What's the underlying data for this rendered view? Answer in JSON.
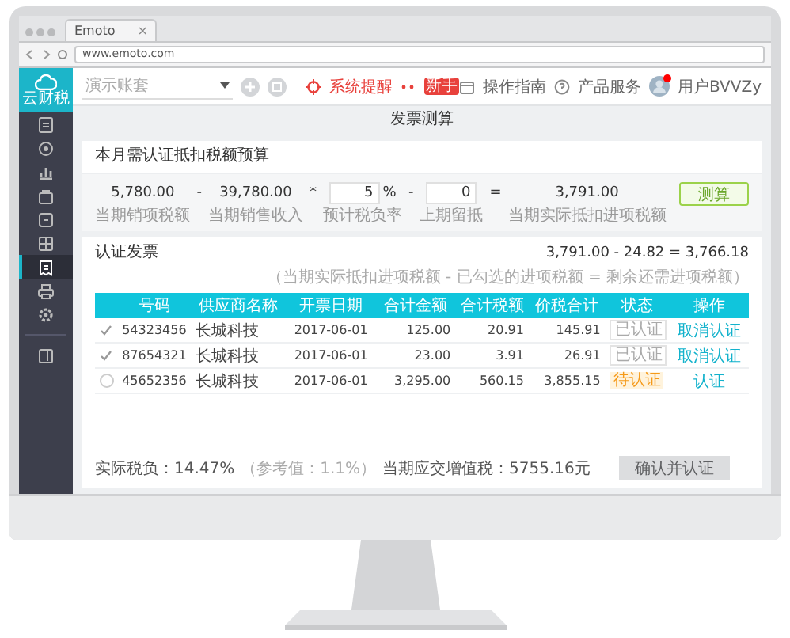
{
  "browser": {
    "tab_title": "Emoto",
    "tab_close": "×",
    "url": "www.emoto.com"
  },
  "header": {
    "logo_text": "云财税",
    "company_select": {
      "placeholder": "演示账套"
    },
    "alert": "系统提醒",
    "new_badge": "新手",
    "guide": "操作指南",
    "service": "产品服务",
    "user": "用户BVVZy",
    "user_notification": true
  },
  "sidebar": {
    "items": [
      {
        "selected": false
      },
      {
        "selected": false
      },
      {
        "selected": false
      },
      {
        "selected": false
      },
      {
        "selected": false
      },
      {
        "selected": false
      },
      {
        "selected": true
      },
      {
        "selected": false
      },
      {
        "selected": false
      },
      {
        "selected": false
      }
    ]
  },
  "page_title": "发票测算",
  "estimate": {
    "title": "本月需认证抵扣税额预算",
    "terms": [
      {
        "kind": "value",
        "value": "5,780.00",
        "label": "当期销项税额"
      },
      {
        "kind": "operator",
        "value": "-"
      },
      {
        "kind": "value",
        "value": "39,780.00",
        "label": "当期销售收入"
      },
      {
        "kind": "operator",
        "value": "*"
      },
      {
        "kind": "input",
        "value": "5",
        "unit": "%",
        "label": "预计税负率"
      },
      {
        "kind": "operator",
        "value": "-"
      },
      {
        "kind": "input",
        "value": "0",
        "label": "上期留抵"
      },
      {
        "kind": "operator",
        "value": "="
      },
      {
        "kind": "value",
        "value": "3,791.00",
        "label": "当期实际抵扣进项税额"
      }
    ],
    "button": "测算"
  },
  "invoices": {
    "title": "认证发票",
    "formula": "3,791.00 - 24.82 = 3,766.18",
    "note": "（当期实际抵扣进项税额 - 已勾选的进项税额 = 剩余还需进项税额）",
    "columns": [
      "号码",
      "供应商名称",
      "开票日期",
      "合计金额",
      "合计税额",
      "价税合计",
      "状态",
      "操作"
    ],
    "rows": [
      {
        "checked": true,
        "cells": [
          "54323456",
          "长城科技",
          "2017-06-01",
          "125.00",
          "20.91",
          "145.91"
        ],
        "status": {
          "text": "已认证",
          "kind": "certified"
        },
        "action": "取消认证"
      },
      {
        "checked": true,
        "cells": [
          "87654321",
          "长城科技",
          "2017-06-01",
          "23.00",
          "3.91",
          "26.91"
        ],
        "status": {
          "text": "已认证",
          "kind": "certified"
        },
        "action": "取消认证"
      },
      {
        "checked": false,
        "cells": [
          "45652356",
          "长城科技",
          "2017-06-01",
          "3,295.00",
          "560.15",
          "3,855.15"
        ],
        "status": {
          "text": "待认证",
          "kind": "pending"
        },
        "action": "认证"
      }
    ],
    "summary": {
      "tax_burden": "实际税负：14.47%",
      "reference": "（参考值：1.1%）",
      "vat_due": "当期应交增值税：5755.16元"
    },
    "confirm_button": {
      "label": "确认并认证",
      "disabled": true
    }
  }
}
